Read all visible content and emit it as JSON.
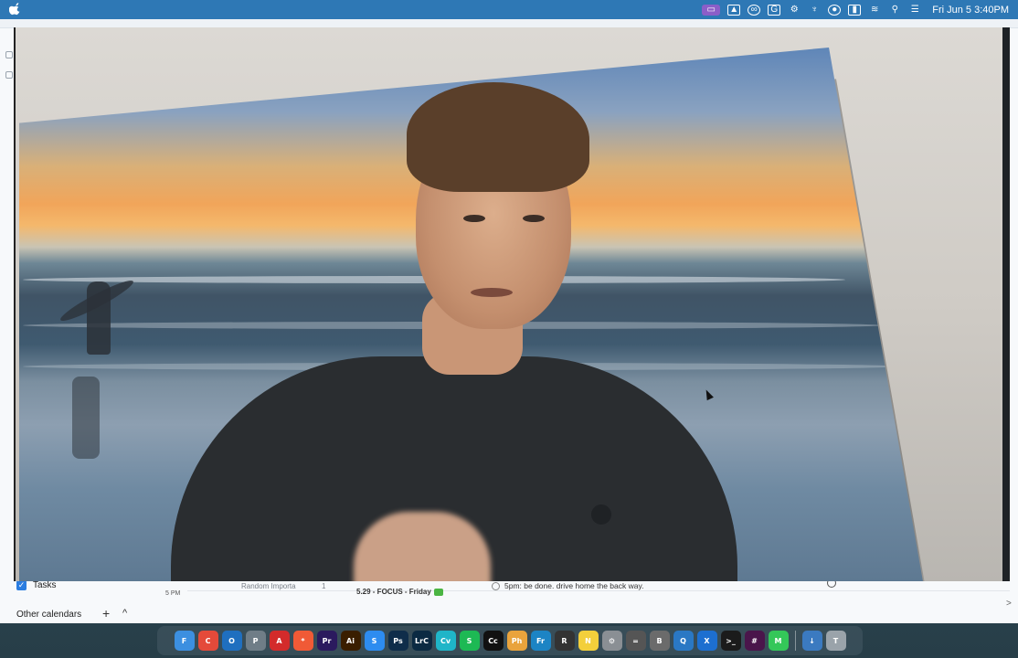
{
  "menubar": {
    "clock": "Fri Jun 5  3:40PM",
    "icons": [
      "apple-menu-icon",
      "screen-share-icon",
      "drive-icon",
      "creative-cloud-icon",
      "grammarly-icon",
      "gear-icon",
      "wrapped-icon",
      "user-icon",
      "battery-icon",
      "wifi-icon",
      "search-icon",
      "control-center-icon"
    ],
    "colors": {
      "bar": "#2e78b5"
    }
  },
  "calendar": {
    "tasks_label": "Tasks",
    "hour_label": "5 PM",
    "events": {
      "e1": "Random Importa",
      "e1_count": "1",
      "e2": "5.29 - FOCUS - Friday",
      "e3": "5pm: be done. drive home the back way."
    },
    "other_calendars": "Other calendars",
    "add_symbol": "+",
    "collapse_symbol": "^",
    "next_symbol": ">"
  },
  "video": {
    "description_color_accent": "#2a2d30"
  },
  "dock": {
    "apps": [
      {
        "name": "Finder",
        "label": "F",
        "color": "#3c8fe0"
      },
      {
        "name": "Chrome",
        "label": "C",
        "color": "#e44a3a"
      },
      {
        "name": "Outlook",
        "label": "O",
        "color": "#1f6fbf"
      },
      {
        "name": "Preview",
        "label": "P",
        "color": "#6f7d87"
      },
      {
        "name": "Acrobat",
        "label": "A",
        "color": "#d32b2b"
      },
      {
        "name": "Perplexity",
        "label": "*",
        "color": "#f05a36"
      },
      {
        "name": "Premiere",
        "label": "Pr",
        "color": "#2b1a5e"
      },
      {
        "name": "Illustrator",
        "label": "Ai",
        "color": "#3a1e00"
      },
      {
        "name": "Spark",
        "label": "S",
        "color": "#2d8cf0"
      },
      {
        "name": "Photoshop",
        "label": "Ps",
        "color": "#0f2d4a"
      },
      {
        "name": "Lightroom",
        "label": "LrC",
        "color": "#0b2a42"
      },
      {
        "name": "Canva",
        "label": "Cv",
        "color": "#1fb5c8"
      },
      {
        "name": "Spotify",
        "label": "S",
        "color": "#1db954"
      },
      {
        "name": "Capcut",
        "label": "Cc",
        "color": "#111111"
      },
      {
        "name": "Photos",
        "label": "Ph",
        "color": "#e9a33c"
      },
      {
        "name": "Freeform",
        "label": "Fr",
        "color": "#1c84c4"
      },
      {
        "name": "Screen Recorder",
        "label": "R",
        "color": "#333333"
      },
      {
        "name": "Notes",
        "label": "N",
        "color": "#f3cf3b"
      },
      {
        "name": "Settings",
        "label": "⚙",
        "color": "#8a8f94"
      },
      {
        "name": "Calculator",
        "label": "=",
        "color": "#555555"
      },
      {
        "name": "Bartender",
        "label": "B",
        "color": "#6b6b6b"
      },
      {
        "name": "Proton",
        "label": "Q",
        "color": "#2a78c4"
      },
      {
        "name": "Xcode",
        "label": "X",
        "color": "#1d6fd0"
      },
      {
        "name": "Terminal",
        "label": ">_",
        "color": "#1b1b1b"
      },
      {
        "name": "Slack",
        "label": "#",
        "color": "#4a154b"
      },
      {
        "name": "Messages",
        "label": "M",
        "color": "#34c759"
      },
      {
        "name": "Downloads",
        "label": "↓",
        "color": "#3b7ac0"
      },
      {
        "name": "Trash",
        "label": "T",
        "color": "#9aa3aa"
      }
    ]
  }
}
